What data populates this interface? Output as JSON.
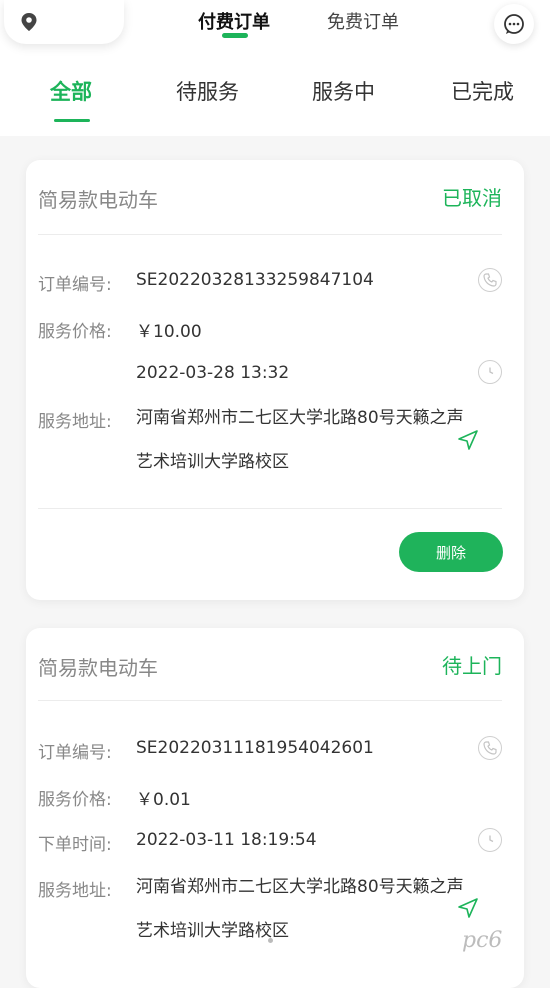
{
  "header": {
    "mode_tabs": [
      {
        "label": "付费订单",
        "active": true
      },
      {
        "label": "免费订单",
        "active": false
      }
    ],
    "icons": {
      "location": "location-pin-icon",
      "message": "chat-bubble-icon"
    }
  },
  "status_tabs": [
    {
      "label": "全部",
      "active": true
    },
    {
      "label": "待服务",
      "active": false
    },
    {
      "label": "服务中",
      "active": false
    },
    {
      "label": "已完成",
      "active": false
    }
  ],
  "orders": [
    {
      "title": "简易款电动车",
      "status": "已取消",
      "order_no_label": "订单编号:",
      "order_no": "SE20220328133259847104",
      "price_label": "服务价格:",
      "price": "￥10.00",
      "time_label": "",
      "time": "2022-03-28 13:32",
      "address_label": "服务地址:",
      "address": "河南省郑州市二七区大学北路80号天籁之声艺术培训大学路校区",
      "delete_label": "删除"
    },
    {
      "title": "简易款电动车",
      "status": "待上门",
      "order_no_label": "订单编号:",
      "order_no": "SE20220311181954042601",
      "price_label": "服务价格:",
      "price": "￥0.01",
      "time_label": "下单时间:",
      "time": "2022-03-11 18:19:54",
      "address_label": "服务地址:",
      "address": "河南省郑州市二七区大学北路80号天籁之声艺术培训大学路校区"
    }
  ],
  "watermark": "pc6",
  "colors": {
    "accent": "#1db45a",
    "background": "#f6f6f6"
  }
}
